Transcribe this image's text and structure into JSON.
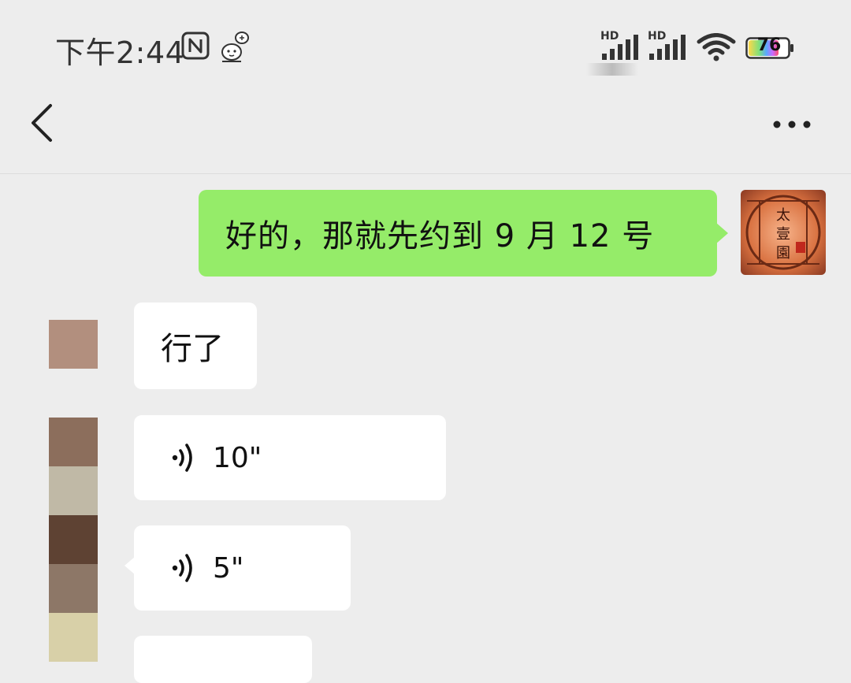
{
  "status_bar": {
    "time": "下午2:44",
    "signal_1_label": "HD",
    "signal_2_label": "HD",
    "battery_level": "76",
    "icons": [
      "nfc-icon",
      "sticker-icon",
      "signal-icon",
      "signal-icon",
      "wifi-icon",
      "battery-icon"
    ]
  },
  "header": {
    "back_icon": "chevron-left-icon",
    "more_icon": "more-dots-icon"
  },
  "messages": [
    {
      "direction": "outgoing",
      "type": "text",
      "text": "好的，那就先约到 9 月 12 号"
    },
    {
      "direction": "incoming",
      "type": "text",
      "text": "行了"
    },
    {
      "direction": "incoming",
      "type": "voice",
      "duration": "10\""
    },
    {
      "direction": "incoming",
      "type": "voice",
      "duration": "5\""
    }
  ],
  "my_avatar": {
    "text_1": "太",
    "text_2": "壹",
    "text_3": "園",
    "seal": "中式"
  },
  "colors": {
    "background": "#ededed",
    "outgoing_bubble": "#95ec69",
    "incoming_bubble": "#ffffff"
  }
}
